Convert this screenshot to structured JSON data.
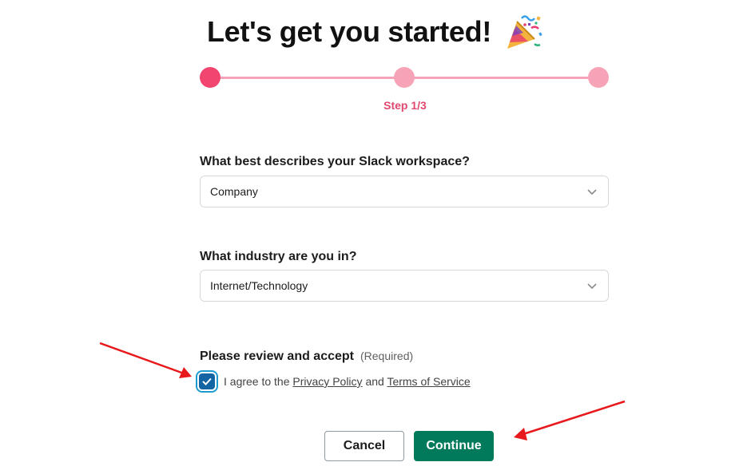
{
  "header": {
    "title": "Let's get you started!",
    "icon": "party-popper-icon"
  },
  "stepper": {
    "total_steps": 3,
    "current_step": 1,
    "label": "Step 1/3",
    "colors": {
      "active": "#f2456f",
      "inactive": "#f7a3b7",
      "line": "#f5a3b8"
    }
  },
  "form": {
    "workspace": {
      "label": "What best describes your Slack workspace?",
      "value": "Company"
    },
    "industry": {
      "label": "What industry are you in?",
      "value": "Internet/Technology"
    },
    "review": {
      "heading": "Please review and accept",
      "required_note": "(Required)",
      "agree_prefix": "I agree to the",
      "privacy_link": "Privacy Policy",
      "conjunction": "and",
      "terms_link": "Terms of Service",
      "checked": true
    }
  },
  "actions": {
    "cancel_label": "Cancel",
    "continue_label": "Continue",
    "continue_color": "#007a5a"
  },
  "annotations": {
    "arrow_color": "#e8191c"
  }
}
